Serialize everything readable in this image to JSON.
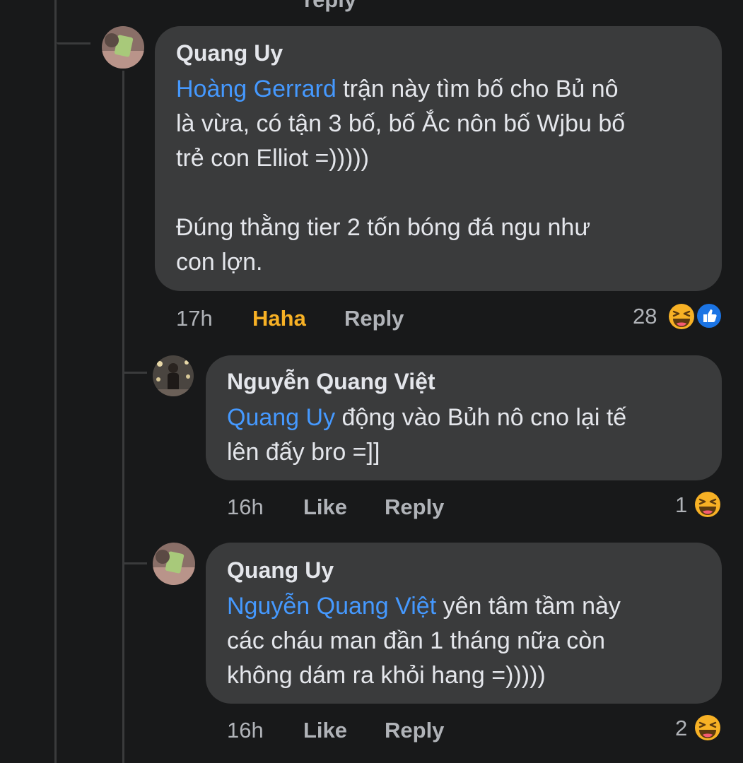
{
  "top_partial_text": "reply",
  "comments": [
    {
      "author": "Quang Uy",
      "mention": "Hoàng Gerrard",
      "text_line1": " trận này tìm bố cho Bủ nô",
      "text_line2": "là vừa, có tận 3 bố, bố Ắc nôn bố Wjbu bố",
      "text_line3": "trẻ con Elliot =)))))",
      "text_line4": "Đúng thằng tier 2 tốn bóng đá ngu như",
      "text_line5": "con lợn.",
      "time": "17h",
      "reaction_action": "Haha",
      "reply_label": "Reply",
      "reaction_count": "28",
      "reactions": [
        "haha-icon",
        "like-icon"
      ]
    },
    {
      "author": "Nguyễn Quang Việt",
      "mention": "Quang Uy",
      "text_line1": " động vào Bủh nô cno lại tế",
      "text_line2": "lên đấy bro =]]",
      "time": "16h",
      "like_label": "Like",
      "reply_label": "Reply",
      "reaction_count": "1",
      "reactions": [
        "haha-icon"
      ]
    },
    {
      "author": "Quang Uy",
      "mention": "Nguyễn Quang Việt",
      "text_line1": " yên tâm tầm này",
      "text_line2": "các cháu man đần 1 tháng nữa còn",
      "text_line3": "không dám ra khỏi hang =)))))",
      "time": "16h",
      "like_label": "Like",
      "reply_label": "Reply",
      "reaction_count": "2",
      "reactions": [
        "haha-icon"
      ]
    }
  ],
  "colors": {
    "background": "#18191a",
    "bubble": "#3a3b3c",
    "mention": "#4599ff",
    "haha_active": "#f7b125",
    "meta": "#b0b3b8",
    "like_blue": "#1b74e4"
  }
}
